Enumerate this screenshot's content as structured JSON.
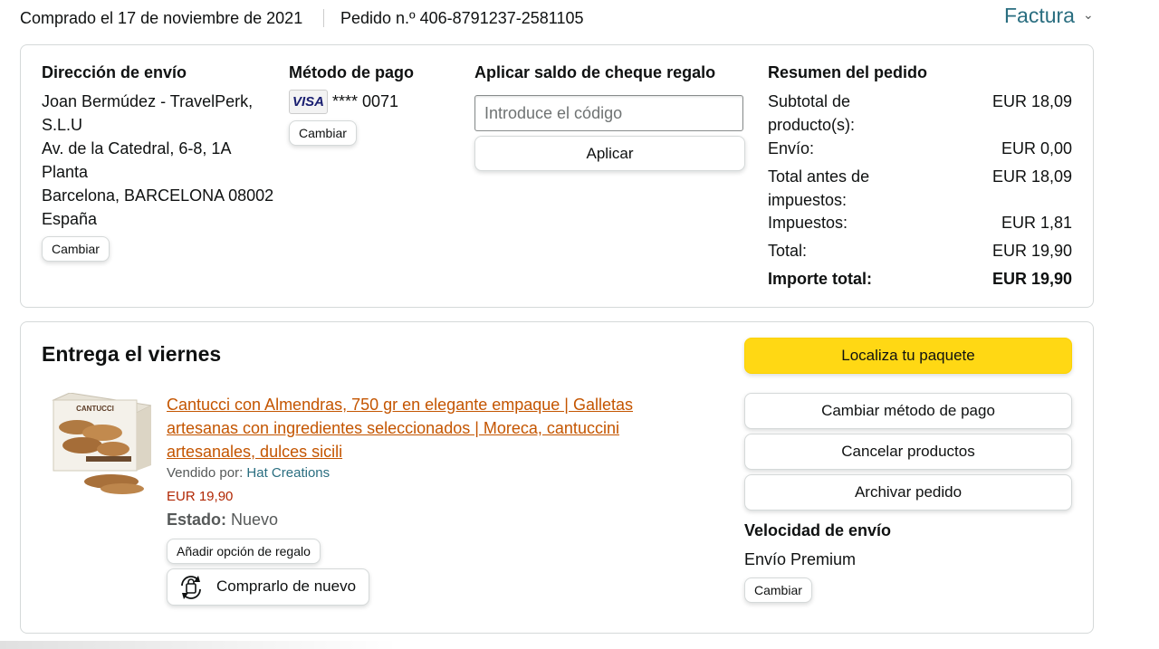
{
  "header": {
    "purchased": "Comprado el 17 de noviembre de 2021",
    "order_number": "Pedido n.º 406-8791237-2581105",
    "invoice_label": "Factura",
    "invoice_chevron": "chevron-down-icon"
  },
  "shipping_address": {
    "title": "Dirección de envío",
    "lines": [
      "Joan Bermúdez - TravelPerk,",
      "S.L.U",
      "Av. de la Catedral, 6-8, 1A",
      "Planta",
      "Barcelona, BARCELONA 08002",
      "España"
    ],
    "change_label": "Cambiar"
  },
  "payment_method": {
    "title": "Método de pago",
    "card_brand": "VISA",
    "card_masked": "**** 0071",
    "change_label": "Cambiar"
  },
  "gift_card": {
    "title": "Aplicar saldo de cheque regalo",
    "placeholder": "Introduce el código",
    "apply_label": "Aplicar"
  },
  "order_summary": {
    "title": "Resumen del pedido",
    "rows": [
      {
        "label": "Subtotal de producto(s):",
        "value": "EUR 18,09"
      },
      {
        "label": "Envío:",
        "value": "EUR 0,00"
      },
      {
        "label": "Total antes de impuestos:",
        "value": "EUR 18,09"
      },
      {
        "label": "Impuestos:",
        "value": "EUR 1,81"
      },
      {
        "label": "Total:",
        "value": "EUR 19,90"
      },
      {
        "label": "Importe total:",
        "value": "EUR 19,90"
      }
    ]
  },
  "delivery": {
    "title": "Entrega el viernes",
    "product": {
      "title": "Cantucci con Almendras, 750 gr en elegante empaque | Galletas artesanas con ingredientes seleccionados | Moreca, cantuccini artesanales, dulces sicili",
      "sold_by_label": "Vendido por:",
      "seller": "Hat Creations",
      "price": "EUR 19,90",
      "status_label": "Estado:",
      "status_value": "Nuevo",
      "box_brand": "CANTUCCI",
      "gift_option_label": "Añadir opción de regalo",
      "buy_again_label": "Comprarlo de nuevo"
    },
    "actions": {
      "track": "Localiza tu paquete",
      "change_payment": "Cambiar método de pago",
      "cancel": "Cancelar productos",
      "archive": "Archivar pedido"
    },
    "shipping_speed": {
      "title": "Velocidad de envío",
      "value": "Envío Premium",
      "change_label": "Cambiar"
    }
  },
  "colors": {
    "link": "#2a6e80",
    "product_link": "#c45500",
    "price": "#b12704",
    "primary_button": "#ffd814"
  }
}
